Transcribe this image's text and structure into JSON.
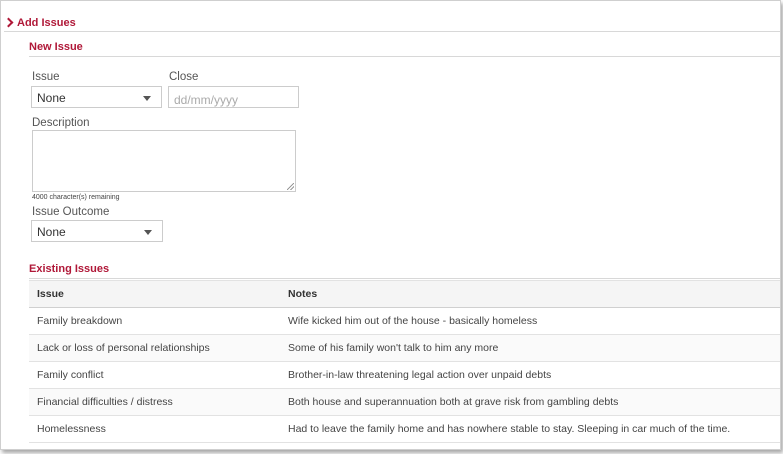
{
  "section": {
    "title": "Add Issues"
  },
  "new_issue": {
    "heading": "New Issue",
    "issue_label": "Issue",
    "issue_value": "None",
    "close_label": "Close",
    "close_placeholder": "dd/mm/yyyy",
    "description_label": "Description",
    "description_value": "",
    "chars_remaining": "4000 character(s) remaining",
    "outcome_label": "Issue Outcome",
    "outcome_value": "None"
  },
  "existing": {
    "heading": "Existing Issues",
    "columns": [
      "Issue",
      "Notes"
    ],
    "rows": [
      {
        "issue": "Family breakdown",
        "notes": "Wife kicked him out of the house - basically homeless"
      },
      {
        "issue": "Lack or loss of personal relationships",
        "notes": "Some of his family won't talk to him any more"
      },
      {
        "issue": "Family conflict",
        "notes": "Brother-in-law threatening legal action over unpaid debts"
      },
      {
        "issue": "Financial difficulties / distress",
        "notes": "Both house and superannuation both at grave risk from gambling debts"
      },
      {
        "issue": "Homelessness",
        "notes": "Had to leave the family home and has nowhere stable to stay. Sleeping in car much of the time."
      }
    ]
  },
  "colors": {
    "accent": "#b01838",
    "border": "#cccccc"
  }
}
